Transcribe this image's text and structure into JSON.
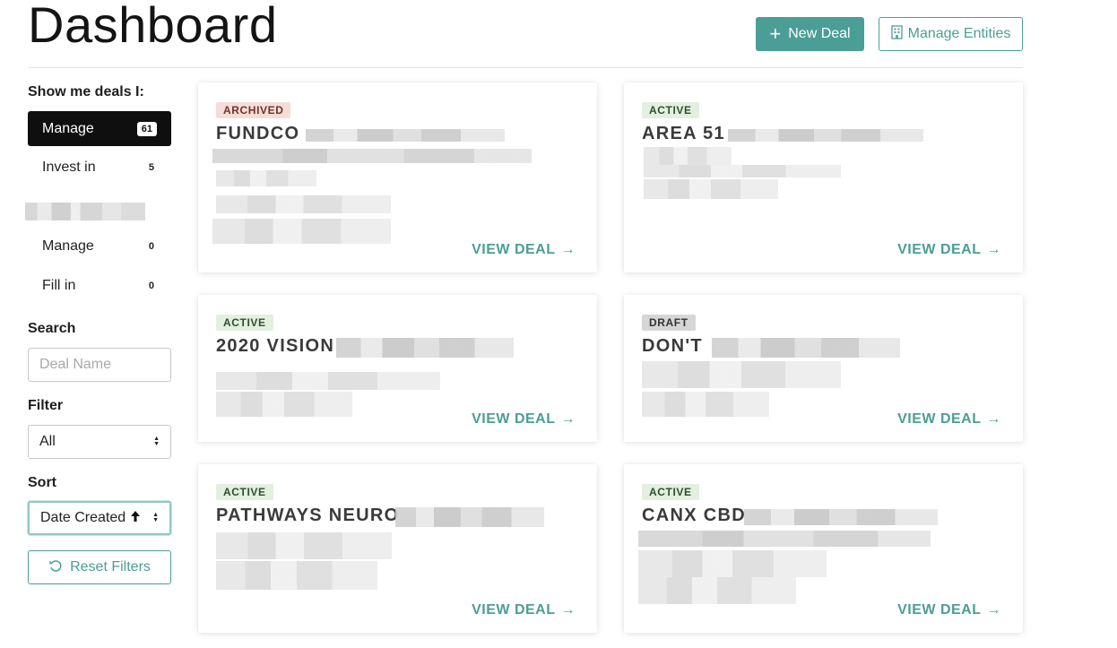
{
  "header": {
    "title": "Dashboard",
    "new_deal_label": "New Deal",
    "manage_entities_label": "Manage Entities"
  },
  "sidebar": {
    "show_me_label": "Show me deals I:",
    "groups": [
      {
        "label": "Manage",
        "count": "61",
        "active": true
      },
      {
        "label": "Invest in",
        "count": "5",
        "active": false
      }
    ],
    "org_groups": [
      {
        "label": "Manage",
        "count": "0"
      },
      {
        "label": "Fill in",
        "count": "0"
      }
    ],
    "search_label": "Search",
    "search_placeholder": "Deal Name",
    "filter_label": "Filter",
    "filter_value": "All",
    "sort_label": "Sort",
    "sort_value": "Date Created",
    "sort_direction_icon": "arrow-up-icon",
    "reset_label": "Reset Filters"
  },
  "cards": [
    {
      "status": "ARCHIVED",
      "status_type": "archived",
      "name": "FUNDCO",
      "cta": "VIEW DEAL"
    },
    {
      "status": "ACTIVE",
      "status_type": "active",
      "name": "AREA 51",
      "cta": "VIEW DEAL"
    },
    {
      "status": "ACTIVE",
      "status_type": "active",
      "name": "2020 VISION",
      "cta": "VIEW DEAL"
    },
    {
      "status": "DRAFT",
      "status_type": "draft",
      "name": "DON'T",
      "cta": "VIEW DEAL"
    },
    {
      "status": "ACTIVE",
      "status_type": "active",
      "name": "PATHWAYS NEURO",
      "cta": "VIEW DEAL"
    },
    {
      "status": "ACTIVE",
      "status_type": "active",
      "name": "CANX CBD",
      "cta": "VIEW DEAL"
    }
  ],
  "colors": {
    "accent": "#4b9e95",
    "active_item_bg": "#0f0f0f",
    "archived_badge_bg": "#f6ddd7",
    "active_badge_bg": "#e3efdf",
    "draft_badge_bg": "#d6d6d6"
  }
}
